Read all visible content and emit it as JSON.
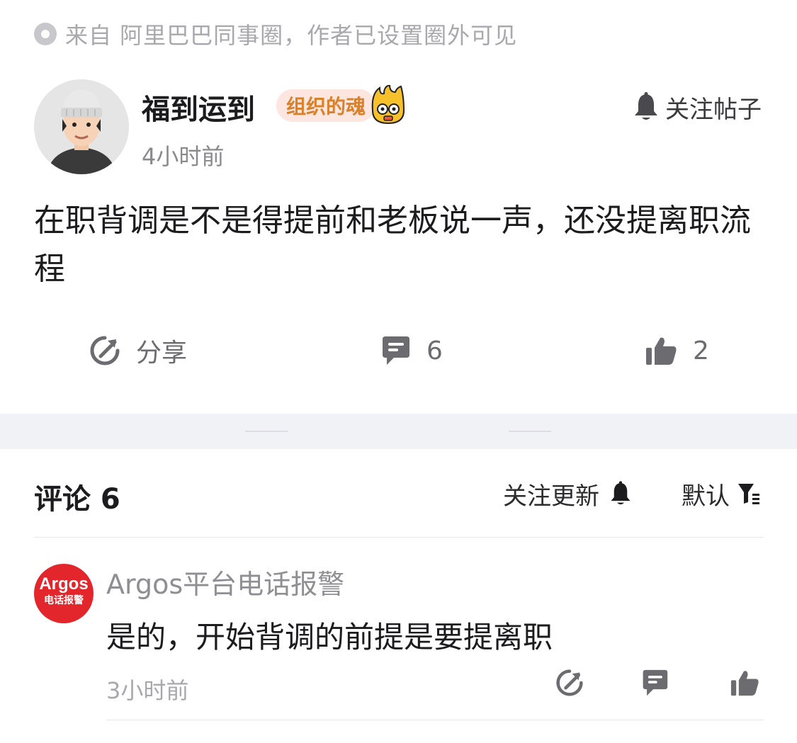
{
  "source": {
    "text": "来自 阿里巴巴同事圈，作者已设置圈外可见",
    "icon": "circle-dot-icon"
  },
  "post": {
    "author": "福到运到",
    "badge": "组织的魂",
    "time": "4小时前",
    "follow_label": "关注帖子",
    "content": "在职背调是不是得提前和老板说一声，还没提离职流程",
    "actions": {
      "share_label": "分享",
      "comment_count": "6",
      "like_count": "2"
    }
  },
  "comments_header": {
    "title": "评论 6",
    "follow_updates": "关注更新",
    "sort_label": "默认"
  },
  "comments": [
    {
      "avatar_line1": "Argos",
      "avatar_line2": "电话报警",
      "name": "Argos平台电话报警",
      "text": "是的，开始背调的前提是要提离职",
      "time": "3小时前"
    }
  ],
  "colors": {
    "accent_badge": "#d9802a",
    "badge_bg": "#fde6df",
    "argos_red": "#e3262b"
  }
}
